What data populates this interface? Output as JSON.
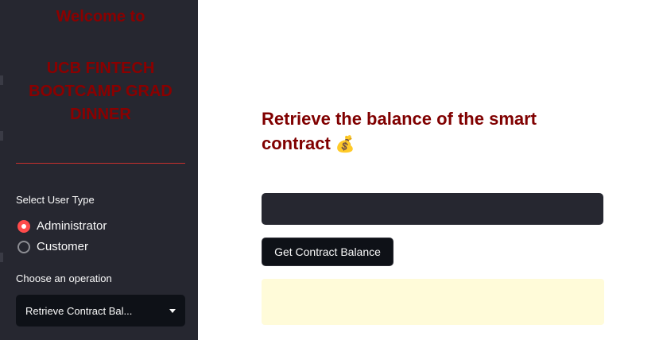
{
  "sidebar": {
    "welcome_line1": "Welcome to",
    "welcome_line2": "UCB FINTECH BOOTCAMP GRAD DINNER",
    "user_type_label": "Select User Type",
    "user_types": [
      {
        "label": "Administrator",
        "selected": true
      },
      {
        "label": "Customer",
        "selected": false
      }
    ],
    "operation_label": "Choose an operation",
    "operation_selected": "Retrieve Contract Bal..."
  },
  "main": {
    "heading": "Retrieve the balance of the smart contract",
    "heading_emoji": "💰",
    "input_value": "",
    "button_label": "Get Contract Balance",
    "alert_text": ""
  },
  "colors": {
    "sidebar_bg": "#262730",
    "title_red": "#8b0000",
    "heading_red": "#800000",
    "radio_accent": "#ff4b4b",
    "alert_bg": "#fffbd9"
  },
  "icons": {
    "heading_emoji": "money-bag-icon",
    "dropdown": "chevron-down-icon"
  }
}
